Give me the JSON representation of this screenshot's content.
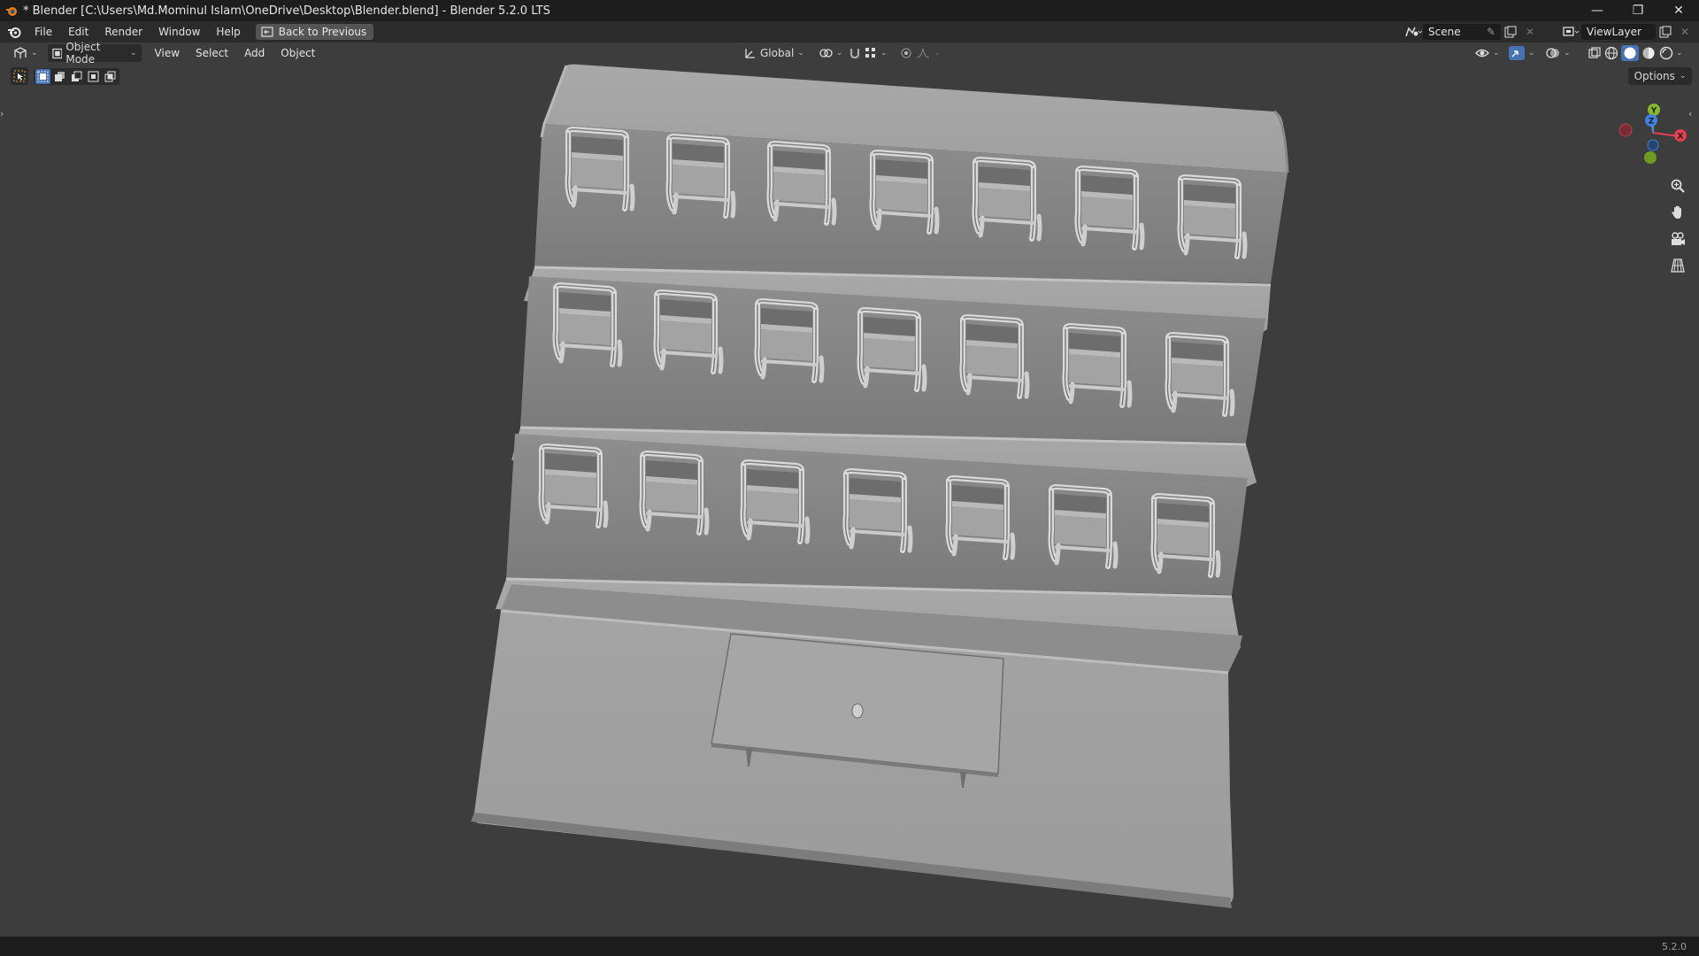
{
  "window": {
    "title": "* Blender [C:\\Users\\Md.Mominul Islam\\OneDrive\\Desktop\\Blender.blend] - Blender 5.2.0 LTS",
    "minimize": "—",
    "maximize": "❐",
    "close": "✕"
  },
  "menu": {
    "items": [
      "File",
      "Edit",
      "Render",
      "Window",
      "Help"
    ],
    "back_button": "Back to Previous",
    "scene": "Scene",
    "view_layer": "ViewLayer"
  },
  "viewport_header": {
    "mode": "Object Mode",
    "menus": [
      "View",
      "Select",
      "Add",
      "Object"
    ],
    "orientation": "Global"
  },
  "viewport": {
    "options_label": "Options",
    "gizmo_axes": [
      "X",
      "Y",
      "Z"
    ],
    "colors": {
      "background": "#3d3d3d",
      "x_axis": "#e0404f",
      "y_axis": "#86b82d",
      "z_axis": "#3f82e3",
      "mesh": "#a5a5a5"
    },
    "scene_objects": {
      "platform_tiers": 4,
      "chair_rows": 3,
      "chairs_per_row": 7,
      "table": 1
    }
  },
  "status": {
    "version": "5.2.0"
  }
}
